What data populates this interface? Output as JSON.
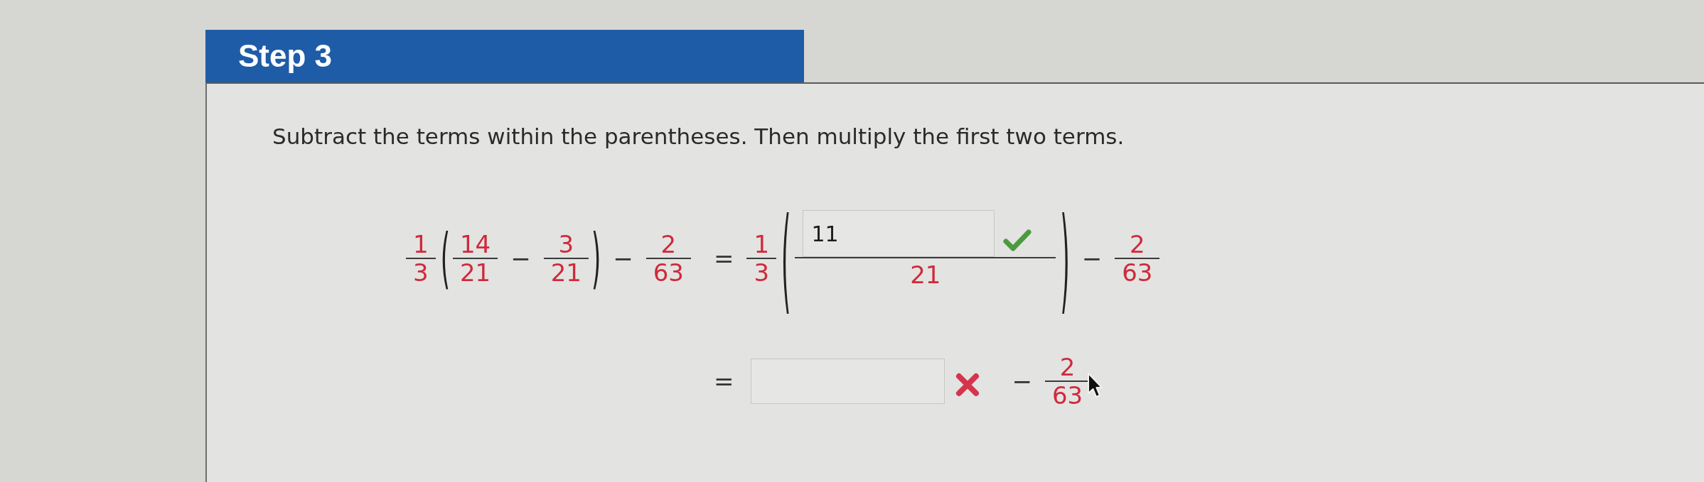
{
  "step": {
    "title": "Step 3"
  },
  "instruction": "Subtract the terms within the parentheses. Then multiply the first two terms.",
  "equation": {
    "rows": [
      {
        "lhs": [
          {
            "kind": "fraction",
            "numerator": "1",
            "denominator": "3"
          },
          {
            "kind": "group",
            "open": "(",
            "close": ")",
            "tokens": [
              {
                "kind": "fraction",
                "numerator": "14",
                "denominator": "21"
              },
              {
                "kind": "operator",
                "text": "−"
              },
              {
                "kind": "fraction",
                "numerator": "3",
                "denominator": "21"
              }
            ]
          },
          {
            "kind": "operator",
            "text": "−"
          },
          {
            "kind": "fraction",
            "numerator": "2",
            "denominator": "63"
          }
        ],
        "rhs": [
          {
            "kind": "operator",
            "text": "="
          },
          {
            "kind": "fraction",
            "numerator": "1",
            "denominator": "3"
          },
          {
            "kind": "group",
            "open": "(",
            "close": ")",
            "tokens": [
              {
                "kind": "answer_fraction",
                "value": "11",
                "denominator": "21",
                "correct": true
              }
            ]
          },
          {
            "kind": "operator",
            "text": "−"
          },
          {
            "kind": "fraction",
            "numerator": "2",
            "denominator": "63"
          }
        ]
      },
      {
        "rhs": [
          {
            "kind": "operator",
            "text": "="
          },
          {
            "kind": "answer",
            "correct": false
          },
          {
            "kind": "operator",
            "text": "−"
          },
          {
            "kind": "fraction",
            "numerator": "2",
            "denominator": "63"
          }
        ]
      }
    ]
  }
}
